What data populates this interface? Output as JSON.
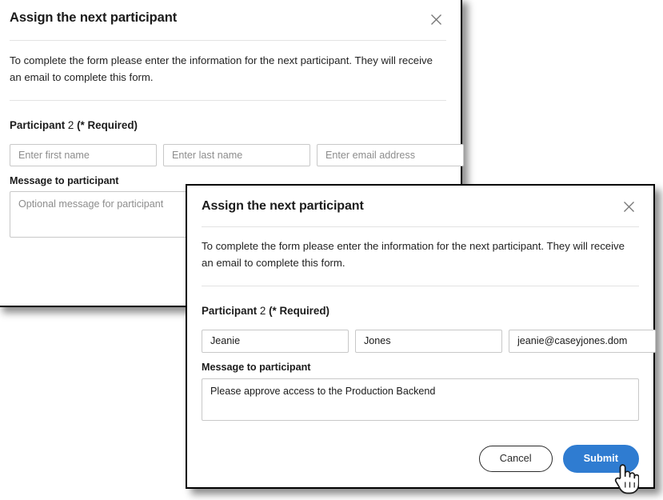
{
  "dialog_back": {
    "title": "Assign the next participant",
    "close_icon": "close-icon",
    "description": "To complete the form please enter the information for the next participant. They will receive an email to complete this form.",
    "section_label_bold": "Participant",
    "section_label_number": " 2 ",
    "section_label_required": "(* Required)",
    "fields": {
      "first_name_placeholder": "Enter first name",
      "first_name_value": "",
      "last_name_placeholder": "Enter last name",
      "last_name_value": "",
      "email_placeholder": "Enter email address",
      "email_value": ""
    },
    "message_label": "Message to participant",
    "message_placeholder": "Optional message for participant",
    "message_value": ""
  },
  "dialog_front": {
    "title": "Assign the next participant",
    "close_icon": "close-icon",
    "description": "To complete the form please enter the information for the next participant. They will receive an email to complete this form.",
    "section_label_bold": "Participant",
    "section_label_number": " 2 ",
    "section_label_required": "(* Required)",
    "fields": {
      "first_name_placeholder": "Enter first name",
      "first_name_value": "Jeanie",
      "last_name_placeholder": "Enter last name",
      "last_name_value": "Jones",
      "email_placeholder": "Enter email address",
      "email_value": "jeanie@caseyjones.dom"
    },
    "message_label": "Message to participant",
    "message_placeholder": "Optional message for participant",
    "message_value": "Please approve access to the Production Backend",
    "cancel_label": "Cancel",
    "submit_label": "Submit"
  },
  "cursor": {
    "icon": "pointing-hand-cursor"
  },
  "colors": {
    "primary_button": "#2f7cd1",
    "dialog_border": "#000000",
    "input_border": "#c8c8c8",
    "placeholder_text": "#8d8d8d",
    "body_text": "#232323"
  }
}
